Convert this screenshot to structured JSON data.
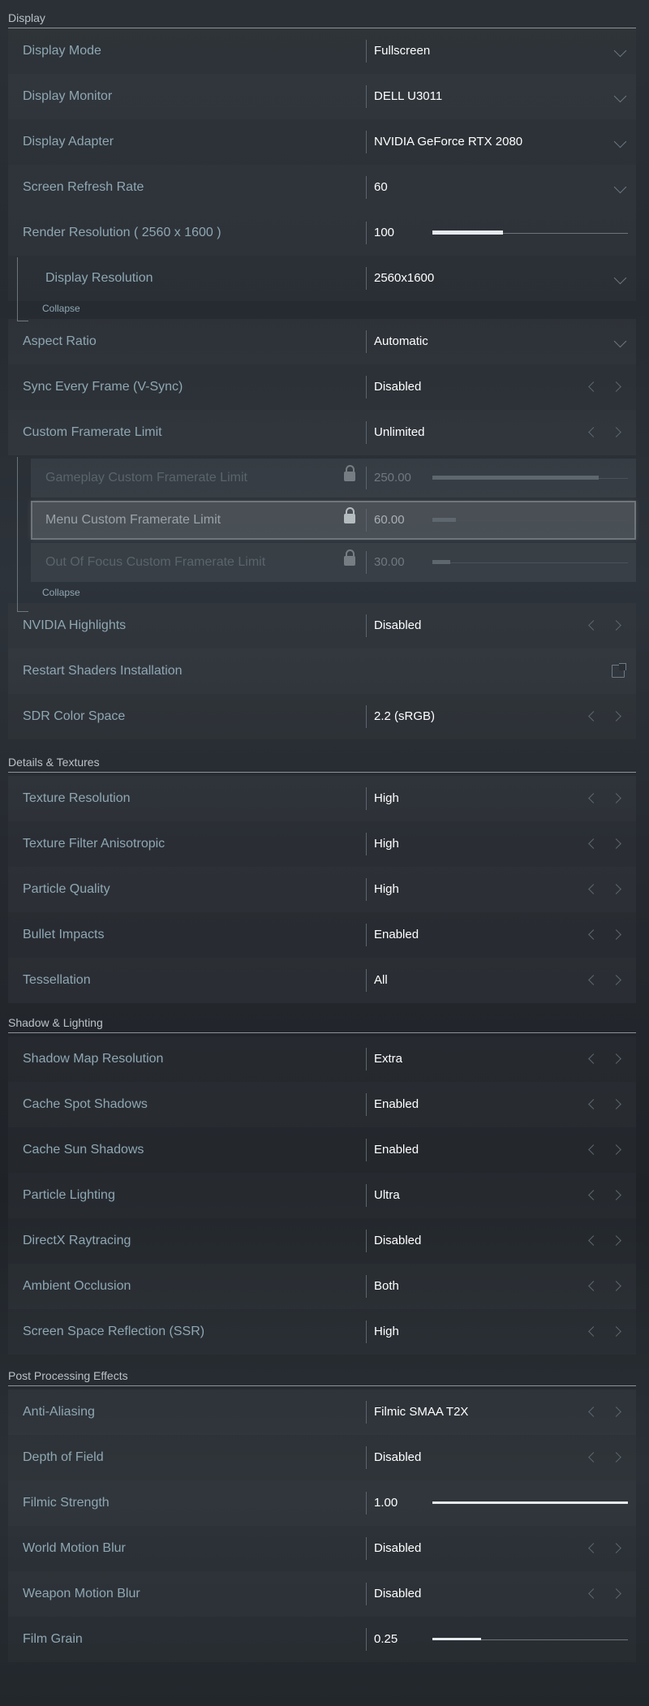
{
  "display": {
    "header": "Display",
    "rows": [
      {
        "label": "Display Mode",
        "value": "Fullscreen"
      },
      {
        "label": "Display Monitor",
        "value": "DELL U3011"
      },
      {
        "label": "Display Adapter",
        "value": "NVIDIA GeForce RTX 2080"
      },
      {
        "label": "Screen Refresh Rate",
        "value": "60"
      },
      {
        "label": "Render Resolution ( 2560 x 1600 )",
        "value": "100",
        "fill": 0.36
      },
      {
        "label": "Display Resolution",
        "value": "2560x1600"
      },
      {
        "label": "Aspect Ratio",
        "value": "Automatic"
      },
      {
        "label": "Sync Every Frame (V-Sync)",
        "value": "Disabled"
      },
      {
        "label": "Custom Framerate Limit",
        "value": "Unlimited"
      },
      {
        "label": "Gameplay Custom Framerate Limit",
        "value": "250.00",
        "fill": 0.85
      },
      {
        "label": "Menu Custom Framerate Limit",
        "value": "60.00",
        "fill": 0.12
      },
      {
        "label": "Out Of Focus Custom Framerate Limit",
        "value": "30.00",
        "fill": 0.09
      },
      {
        "label": "NVIDIA Highlights",
        "value": "Disabled"
      },
      {
        "label": "Restart Shaders Installation",
        "value": ""
      },
      {
        "label": "SDR Color Space",
        "value": "2.2 (sRGB)"
      }
    ],
    "collapse_1": "Collapse",
    "collapse_2": "Collapse"
  },
  "details": {
    "header": "Details & Textures",
    "rows": [
      {
        "label": "Texture Resolution",
        "value": "High"
      },
      {
        "label": "Texture Filter Anisotropic",
        "value": "High"
      },
      {
        "label": "Particle Quality",
        "value": "High"
      },
      {
        "label": "Bullet Impacts",
        "value": "Enabled"
      },
      {
        "label": "Tessellation",
        "value": "All"
      }
    ]
  },
  "shadow": {
    "header": "Shadow & Lighting",
    "rows": [
      {
        "label": "Shadow Map Resolution",
        "value": "Extra"
      },
      {
        "label": "Cache Spot Shadows",
        "value": "Enabled"
      },
      {
        "label": "Cache Sun Shadows",
        "value": "Enabled"
      },
      {
        "label": "Particle Lighting",
        "value": "Ultra"
      },
      {
        "label": "DirectX Raytracing",
        "value": "Disabled"
      },
      {
        "label": "Ambient Occlusion",
        "value": "Both"
      },
      {
        "label": "Screen Space Reflection (SSR)",
        "value": "High"
      }
    ]
  },
  "post": {
    "header": "Post Processing Effects",
    "rows": [
      {
        "label": "Anti-Aliasing",
        "value": "Filmic SMAA T2X"
      },
      {
        "label": "Depth of Field",
        "value": "Disabled"
      },
      {
        "label": "Filmic Strength",
        "value": "1.00",
        "fill": 1.0
      },
      {
        "label": "World Motion Blur",
        "value": "Disabled"
      },
      {
        "label": "Weapon Motion Blur",
        "value": "Disabled"
      },
      {
        "label": "Film Grain",
        "value": "0.25",
        "fill": 0.25
      }
    ]
  },
  "icons": {
    "dropdown": "chevron-down-icon",
    "prev": "chevron-left-icon",
    "next": "chevron-right-icon",
    "external": "external-link-icon",
    "lock": "lock-icon"
  },
  "colors": {
    "label": "#8fa7b3",
    "value": "#ffffff",
    "accent_fill": "#e6e9eb"
  }
}
